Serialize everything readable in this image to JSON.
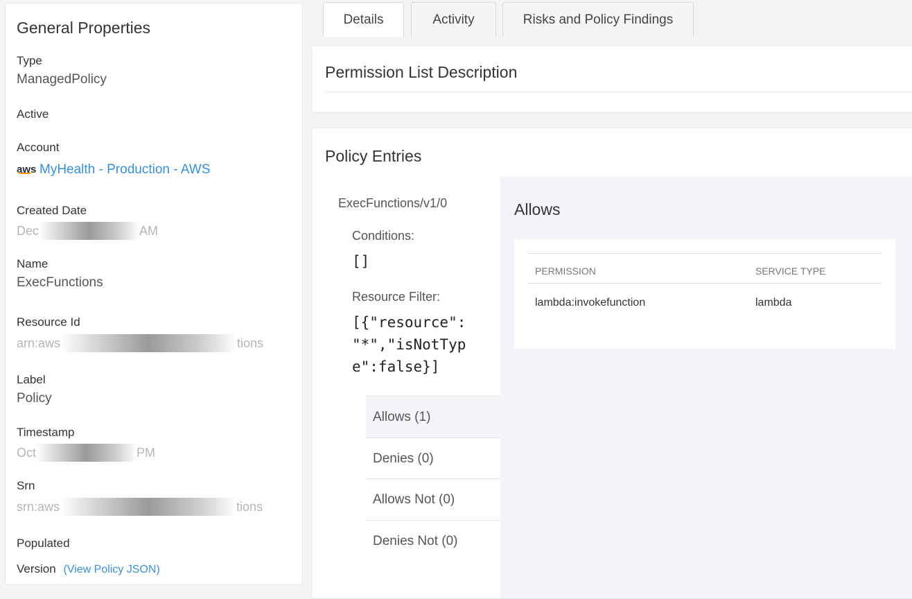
{
  "general": {
    "title": "General Properties",
    "type_label": "Type",
    "type_value": "ManagedPolicy",
    "active_label": "Active",
    "account_label": "Account",
    "account_logo_text": "aws",
    "account_value": "MyHealth - Production - AWS",
    "created_label": "Created Date",
    "created_start": "Dec",
    "created_end": "AM",
    "name_label": "Name",
    "name_value": "ExecFunctions",
    "resource_label": "Resource Id",
    "resource_start": "arn:aws",
    "resource_end": "tions",
    "label_label": "Label",
    "label_value": "Policy",
    "timestamp_label": "Timestamp",
    "timestamp_start": "Oct",
    "timestamp_end": "PM",
    "srn_label": "Srn",
    "srn_start": "srn:aws",
    "srn_end": "tions",
    "populated_label": "Populated",
    "version_label": "Version",
    "version_link": "(View Policy JSON)"
  },
  "tabs": [
    "Details",
    "Activity",
    "Risks and Policy Findings"
  ],
  "permission_card": {
    "title": "Permission List Description"
  },
  "policy": {
    "title": "Policy Entries",
    "entry_name": "ExecFunctions/v1/0",
    "conditions_label": "Conditions:",
    "conditions_value": "[]",
    "resource_filter_label": "Resource Filter:",
    "resource_filter_lines": [
      "[{\"resource\":",
      "\"*\",\"isNotTyp",
      "e\":false}]"
    ],
    "sub_tabs": [
      "Allows (1)",
      "Denies (0)",
      "Allows Not (0)",
      "Denies Not (0)"
    ],
    "allows_title": "Allows",
    "columns": [
      "PERMISSION",
      "SERVICE TYPE"
    ],
    "rows": [
      {
        "permission": "lambda:invokefunction",
        "service_type": "lambda"
      }
    ]
  }
}
